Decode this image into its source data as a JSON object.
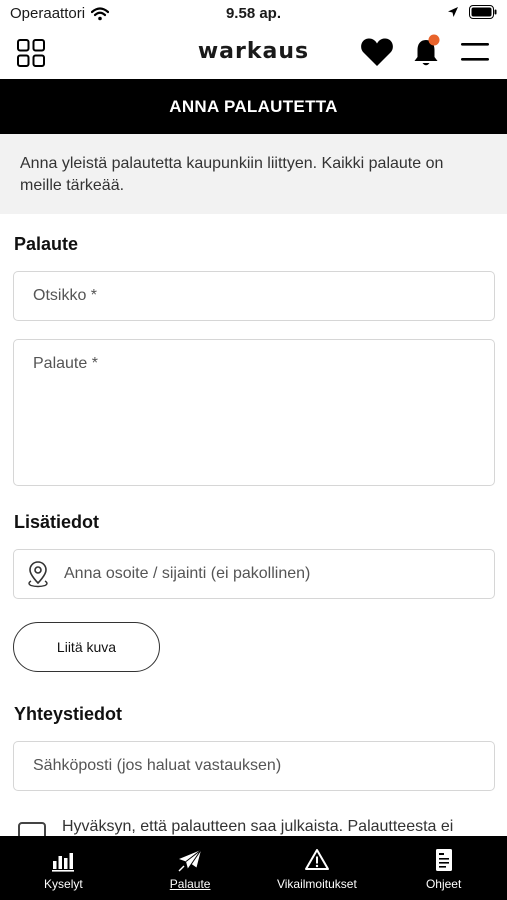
{
  "status_bar": {
    "carrier": "Operaattori",
    "time": "9.58 ap."
  },
  "header": {
    "logo": "warkaus",
    "notification_dot_color": "#e8632b"
  },
  "page_title": "ANNA PALAUTETTA",
  "intro_text": "Anna yleistä palautetta kaupunkiin liittyen. Kaikki palaute on meille tärkeää.",
  "sections": {
    "feedback_title": "Palaute",
    "extra_title": "Lisätiedot",
    "contact_title": "Yhteystiedot"
  },
  "form": {
    "subject_placeholder": "Otsikko *",
    "feedback_placeholder": "Palaute *",
    "location_placeholder": "Anna osoite / sijainti (ei pakollinen)",
    "attach_label": "Liitä kuva",
    "email_placeholder": "Sähköposti (jos haluat vastauksen)",
    "consent_text": "Hyväksyn, että palautteen saa julkaista. Palautteesta ei"
  },
  "bottom_nav": [
    {
      "label": "Kyselyt",
      "icon": "bar-chart-icon",
      "active": false
    },
    {
      "label": "Palaute",
      "icon": "paper-plane-icon",
      "active": true
    },
    {
      "label": "Vikailmoitukset",
      "icon": "warning-icon",
      "active": false
    },
    {
      "label": "Ohjeet",
      "icon": "document-icon",
      "active": false
    }
  ]
}
